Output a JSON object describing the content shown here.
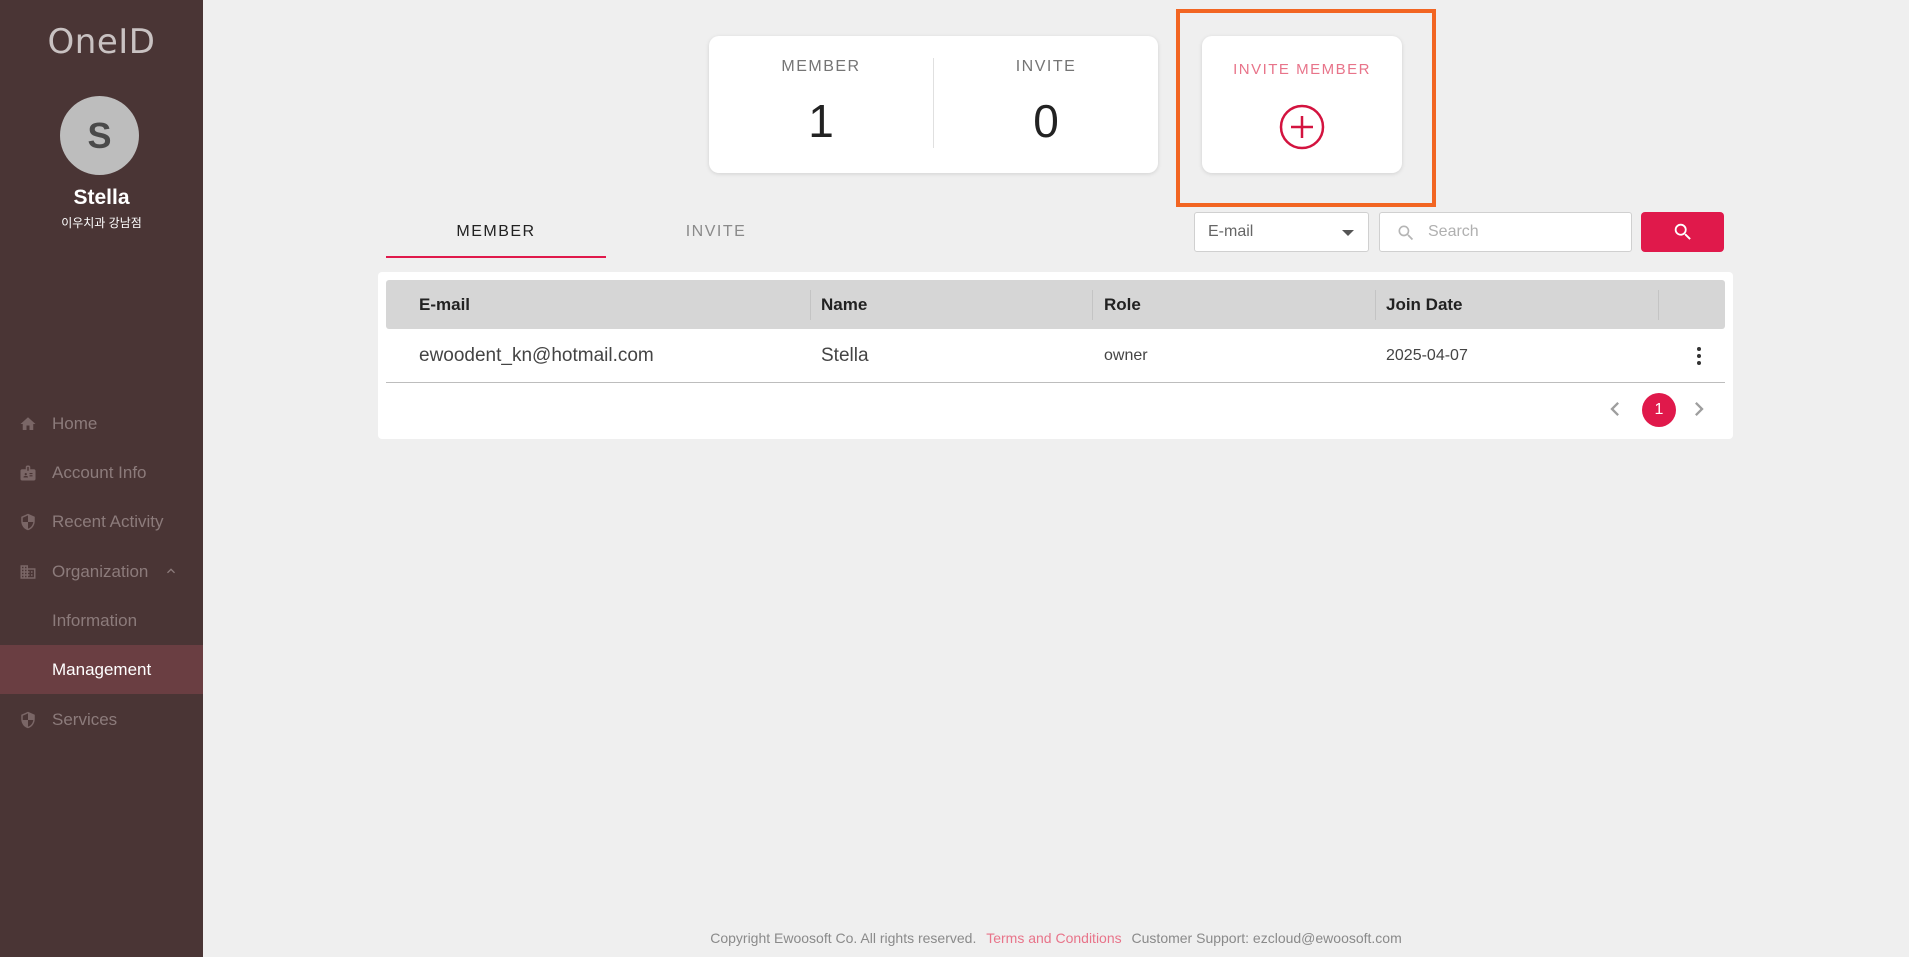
{
  "sidebar": {
    "logo": "OneID",
    "avatar_initial": "S",
    "user_name": "Stella",
    "user_org": "이우치과 강남점",
    "items": [
      {
        "label": "Home",
        "icon": "home-icon"
      },
      {
        "label": "Account Info",
        "icon": "id-card-icon"
      },
      {
        "label": "Recent Activity",
        "icon": "shield-icon"
      },
      {
        "label": "Organization",
        "icon": "building-icon"
      },
      {
        "label": "Information"
      },
      {
        "label": "Management"
      },
      {
        "label": "Services",
        "icon": "shield-icon"
      }
    ]
  },
  "stats": {
    "member_label": "MEMBER",
    "member_value": "1",
    "invite_label": "INVITE",
    "invite_value": "0"
  },
  "invite_card": {
    "label": "INVITE MEMBER"
  },
  "tabs": [
    {
      "label": "MEMBER",
      "active": true
    },
    {
      "label": "INVITE",
      "active": false
    }
  ],
  "search": {
    "filter_value": "E-mail",
    "placeholder": "Search"
  },
  "table": {
    "columns": [
      "E-mail",
      "Name",
      "Role",
      "Join Date"
    ],
    "rows": [
      {
        "email": "ewoodent_kn@hotmail.com",
        "name": "Stella",
        "role": "owner",
        "join_date": "2025-04-07"
      }
    ]
  },
  "pagination": {
    "current_page": "1"
  },
  "footer": {
    "copyright": "Copyright Ewoosoft Co. All rights reserved.",
    "terms": "Terms and Conditions",
    "support": "Customer Support: ezcloud@ewoosoft.com"
  },
  "colors": {
    "sidebar_bg": "#4a3535",
    "accent": "#e0194b",
    "highlight": "#f26522"
  }
}
